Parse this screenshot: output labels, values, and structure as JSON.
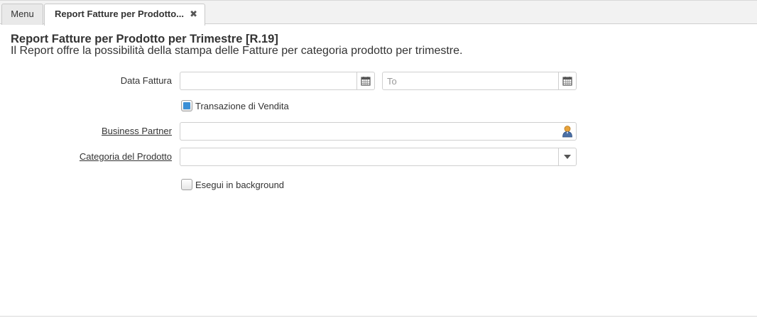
{
  "tabs": {
    "menu_label": "Menu",
    "report_label": "Report Fatture per Prodotto...",
    "close_glyph": "✖"
  },
  "page": {
    "title": "Report Fatture per Prodotto per Trimestre [R.19]",
    "description": "Il Report offre la possibilità della stampa delle Fatture per categoria prodotto per trimestre."
  },
  "form": {
    "data_fattura": {
      "label": "Data Fattura",
      "from_value": "",
      "to_value": "",
      "to_placeholder": "To",
      "icon": "calendar-icon"
    },
    "transazione_vendita": {
      "label": "Transazione di Vendita",
      "checked": true
    },
    "business_partner": {
      "label": "Business Partner",
      "value": "",
      "icon": "business-partner-icon"
    },
    "categoria_prodotto": {
      "label": "Categoria del Prodotto",
      "value": "",
      "icon": "dropdown-arrow-icon"
    },
    "esegui_background": {
      "label": "Esegui in background",
      "checked": false
    }
  },
  "colors": {
    "accent": "#3b8fd6",
    "border": "#cfcfcf",
    "tab_background": "#f2f2f2"
  }
}
